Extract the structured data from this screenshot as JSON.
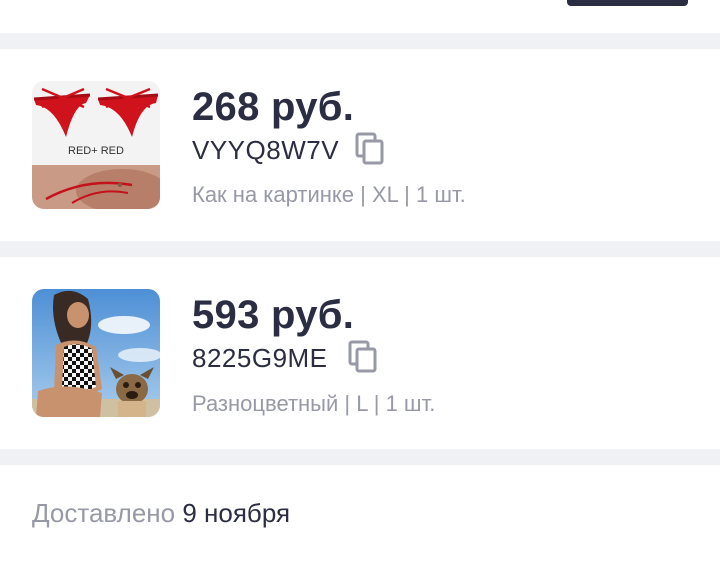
{
  "items": [
    {
      "price": "268 руб.",
      "code": "VYYQ8W7V",
      "details": "Как на картинке | XL | 1 шт.",
      "image_text": "RED+ RED",
      "image_icon": "product-photo-red-underwear"
    },
    {
      "price": "593 руб.",
      "code": "8225G9ME",
      "details": "Разноцветный | L | 1 шт.",
      "image_icon": "product-photo-checkered-swimsuit"
    }
  ],
  "delivery": {
    "label": "Доставлено",
    "date": "9 ноября"
  },
  "colors": {
    "text": "#2b2d42",
    "muted": "#9799a6",
    "separator": "#eff1f5"
  }
}
